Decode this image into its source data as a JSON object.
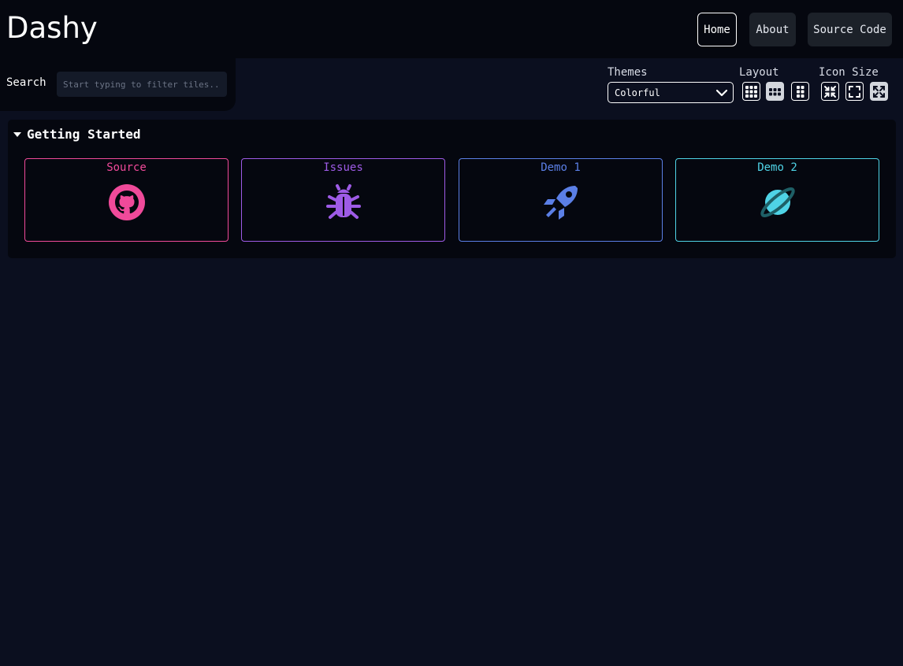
{
  "header": {
    "title": "Dashy",
    "nav": [
      {
        "label": "Home",
        "active": true
      },
      {
        "label": "About",
        "active": false
      },
      {
        "label": "Source Code",
        "active": false
      }
    ]
  },
  "search": {
    "label": "Search",
    "placeholder": "Start typing to filter tiles..",
    "value": ""
  },
  "settings": {
    "themes_label": "Themes",
    "theme_value": "Colorful",
    "layout_label": "Layout",
    "layout_options": [
      "auto-layout-icon",
      "horizontal-layout-icon",
      "vertical-layout-icon"
    ],
    "layout_selected": "horizontal-layout-icon",
    "icon_size_label": "Icon Size",
    "icon_size_options": [
      "small-icon-size-icon",
      "medium-icon-size-icon",
      "large-icon-size-icon"
    ],
    "icon_size_selected": "large-icon-size-icon"
  },
  "section": {
    "title": "Getting Started",
    "tiles": [
      {
        "label": "Source",
        "icon": "github-icon",
        "color": "#f04a9a"
      },
      {
        "label": "Issues",
        "icon": "bug-icon",
        "color": "#9e5be6"
      },
      {
        "label": "Demo 1",
        "icon": "rocket-icon",
        "color": "#5b7fe6"
      },
      {
        "label": "Demo 2",
        "icon": "planet-icon",
        "color": "#4fd3e6"
      }
    ]
  }
}
